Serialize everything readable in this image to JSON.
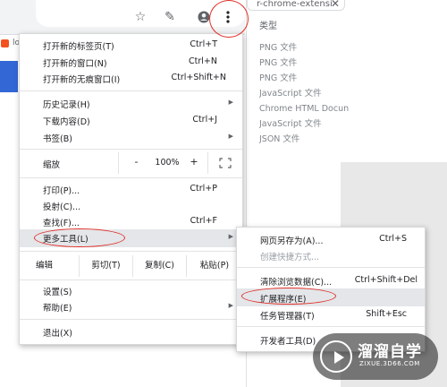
{
  "browser": {
    "toolbar_icons": [
      "star-icon",
      "extension-icon",
      "account-icon",
      "more-vert-icon"
    ],
    "left_tab_text": "lo"
  },
  "behind_page": {
    "url_fragment": "r-chrome-extensi",
    "type_header": "类型",
    "type_items": [
      "PNG 文件",
      "PNG 文件",
      "PNG 文件",
      "JavaScript 文件",
      "Chrome HTML Docun",
      "JavaScript 文件",
      "JSON 文件"
    ]
  },
  "menu": {
    "new_tab": {
      "label": "打开新的标签页(T)",
      "shortcut": "Ctrl+T"
    },
    "new_window": {
      "label": "打开新的窗口(N)",
      "shortcut": "Ctrl+N"
    },
    "new_incognito": {
      "label": "打开新的无痕窗口(I)",
      "shortcut": "Ctrl+Shift+N"
    },
    "history": {
      "label": "历史记录(H)"
    },
    "downloads": {
      "label": "下载内容(D)",
      "shortcut": "Ctrl+J"
    },
    "bookmarks": {
      "label": "书签(B)"
    },
    "zoom": {
      "label": "缩放",
      "minus": "-",
      "value": "100%",
      "plus": "+"
    },
    "print": {
      "label": "打印(P)...",
      "shortcut": "Ctrl+P"
    },
    "cast": {
      "label": "投射(C)..."
    },
    "find": {
      "label": "查找(F)...",
      "shortcut": "Ctrl+F"
    },
    "more_tools": {
      "label": "更多工具(L)"
    },
    "edit": {
      "label": "编辑",
      "cut": "剪切(T)",
      "copy": "复制(C)",
      "paste": "粘贴(P)"
    },
    "settings": {
      "label": "设置(S)"
    },
    "help": {
      "label": "帮助(E)"
    },
    "exit": {
      "label": "退出(X)"
    }
  },
  "submenu": {
    "save_page": {
      "label": "网页另存为(A)...",
      "shortcut": "Ctrl+S"
    },
    "create_shortcut": {
      "label": "创建快捷方式..."
    },
    "clear_data": {
      "label": "清除浏览数据(C)...",
      "shortcut": "Ctrl+Shift+Del"
    },
    "extensions": {
      "label": "扩展程序(E)"
    },
    "task_manager": {
      "label": "任务管理器(T)",
      "shortcut": "Shift+Esc"
    },
    "dev_tools": {
      "label": "开发者工具(D)"
    }
  },
  "watermark": {
    "title": "溜溜自学",
    "subtitle": "ZIXUE.3D66.COM"
  },
  "colors": {
    "annotation_red": "#e0312a",
    "highlight": "#e4e6e9",
    "accent_blue": "#3367d6"
  }
}
